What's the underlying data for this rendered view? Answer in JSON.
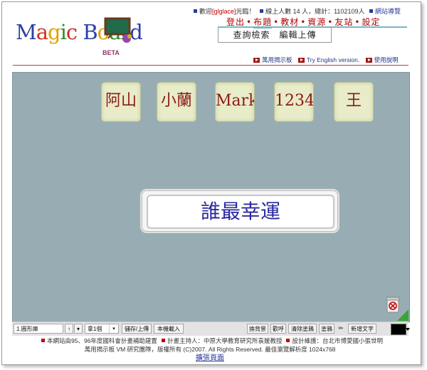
{
  "header": {
    "logo_letters": [
      {
        "ch": "M",
        "color": "#2b3fa8"
      },
      {
        "ch": "a",
        "color": "#d03020"
      },
      {
        "ch": "g",
        "color": "#e0a000"
      },
      {
        "ch": "i",
        "color": "#2c8c2c"
      },
      {
        "ch": "c",
        "color": "#d03020"
      },
      {
        "ch": " ",
        "color": "#000"
      },
      {
        "ch": "B",
        "color": "#2b3fa8"
      },
      {
        "ch": "o",
        "color": "#e0a000"
      },
      {
        "ch": "a",
        "color": "#2c8c2c"
      },
      {
        "ch": "r",
        "color": "#d03020"
      },
      {
        "ch": "d",
        "color": "#2b3fa8"
      }
    ],
    "beta": "BETA",
    "welcome_prefix": "歡迎",
    "username": "[glglace]",
    "welcome_suffix": "光臨！",
    "online": "線上人數 14 人，總計：1102109人",
    "site_nav": "網站導覽",
    "menu": [
      "登出",
      "布題",
      "教材",
      "資源",
      "友站",
      "設定"
    ],
    "menu_current": 1,
    "sub_menu": "查詢檢索　編輯上傳",
    "links": [
      "萬用揭示板",
      "Try English version.",
      "使用說明"
    ]
  },
  "board": {
    "cards": [
      "阿山",
      "小蘭",
      "Mark",
      "1234",
      "王"
    ],
    "title": "誰最幸運"
  },
  "toolbar": {
    "shape_select": "1.圓形庫",
    "up_label": "↑",
    "count_select": "拿1個",
    "save": "儲存/上傳",
    "load": "本機載入",
    "toggle_size": "換背景",
    "cheer": "歡呼",
    "clear": "清除塗鴉",
    "draw": "塗鴉",
    "add_text": "新增文字",
    "color": "#000000"
  },
  "footer": {
    "line1": [
      "本網站由95、96年度國科會計畫補助建置",
      "計畫主持人：中原大學教育研究所袁媛教授",
      "設計維護：台北市博愛國小張世明"
    ],
    "line2": "萬用揭示板 VM 研究團隊，版權所有 (C)2007. All Rights Reserved. 最佳瀏覽解析度 1024x768",
    "home": "擴張頁面"
  }
}
